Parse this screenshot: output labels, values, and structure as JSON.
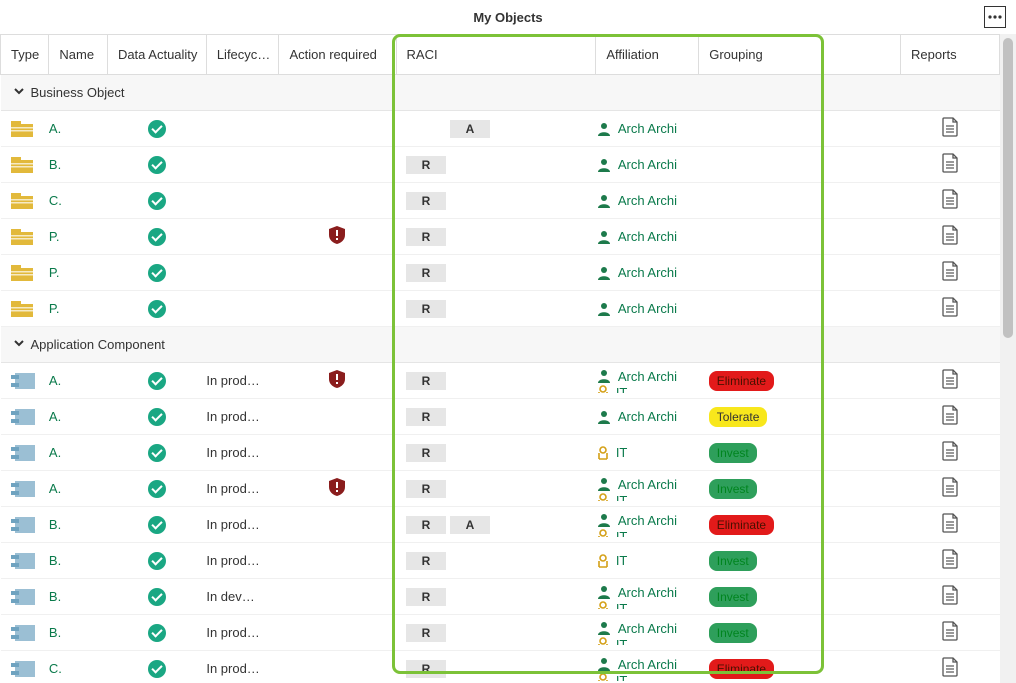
{
  "title": "My Objects",
  "columns": {
    "type": "Type",
    "name": "Name",
    "actuality": "Data Actuality",
    "lifecycle": "Lifecyc…",
    "action": "Action required",
    "raci": "RACI",
    "affiliation": "Affiliation",
    "grouping": "Grouping",
    "reports": "Reports"
  },
  "groups": [
    {
      "label": "Business Object",
      "rows": [
        {
          "name": "A.",
          "actuality": "ok",
          "lifecycle": "",
          "action": "",
          "raci": [
            "A"
          ],
          "raci_offset": 1,
          "aff": [
            {
              "icon": "person",
              "text": "Arch Archi"
            }
          ],
          "group": ""
        },
        {
          "name": "B.",
          "actuality": "ok",
          "lifecycle": "",
          "action": "",
          "raci": [
            "R"
          ],
          "aff": [
            {
              "icon": "person",
              "text": "Arch Archi"
            }
          ],
          "group": ""
        },
        {
          "name": "C.",
          "actuality": "ok",
          "lifecycle": "",
          "action": "",
          "raci": [
            "R"
          ],
          "aff": [
            {
              "icon": "person",
              "text": "Arch Archi"
            }
          ],
          "group": ""
        },
        {
          "name": "P.",
          "actuality": "ok",
          "lifecycle": "",
          "action": "alert",
          "raci": [
            "R"
          ],
          "aff": [
            {
              "icon": "person",
              "text": "Arch Archi"
            }
          ],
          "group": ""
        },
        {
          "name": "P.",
          "actuality": "ok",
          "lifecycle": "",
          "action": "",
          "raci": [
            "R"
          ],
          "aff": [
            {
              "icon": "person",
              "text": "Arch Archi"
            }
          ],
          "group": ""
        },
        {
          "name": "P.",
          "actuality": "ok",
          "lifecycle": "",
          "action": "",
          "raci": [
            "R"
          ],
          "aff": [
            {
              "icon": "person",
              "text": "Arch Archi"
            }
          ],
          "group": ""
        }
      ]
    },
    {
      "label": "Application Component",
      "rows": [
        {
          "name": "A.",
          "actuality": "ok",
          "lifecycle": "In prod…",
          "action": "alert",
          "raci": [
            "R"
          ],
          "aff": [
            {
              "icon": "person",
              "text": "Arch Archi"
            },
            {
              "icon": "badge",
              "text": "IT",
              "partial": true
            }
          ],
          "group": "Eliminate"
        },
        {
          "name": "A.",
          "actuality": "ok",
          "lifecycle": "In prod…",
          "action": "",
          "raci": [
            "R"
          ],
          "aff": [
            {
              "icon": "person",
              "text": "Arch Archi"
            }
          ],
          "group": "Tolerate"
        },
        {
          "name": "A.",
          "actuality": "ok",
          "lifecycle": "In prod…",
          "action": "",
          "raci": [
            "R"
          ],
          "aff": [
            {
              "icon": "badge",
              "text": "IT"
            }
          ],
          "group": "Invest"
        },
        {
          "name": "A.",
          "actuality": "ok",
          "lifecycle": "In prod…",
          "action": "alert",
          "raci": [
            "R"
          ],
          "aff": [
            {
              "icon": "person",
              "text": "Arch Archi"
            },
            {
              "icon": "badge",
              "text": "IT",
              "partial": true
            }
          ],
          "group": "Invest"
        },
        {
          "name": "B.",
          "actuality": "ok",
          "lifecycle": "In prod…",
          "action": "",
          "raci": [
            "R",
            "A"
          ],
          "aff": [
            {
              "icon": "person",
              "text": "Arch Archi"
            },
            {
              "icon": "badge",
              "text": "IT",
              "partial": true
            }
          ],
          "group": "Eliminate"
        },
        {
          "name": "B.",
          "actuality": "ok",
          "lifecycle": "In prod…",
          "action": "",
          "raci": [
            "R"
          ],
          "aff": [
            {
              "icon": "badge",
              "text": "IT"
            }
          ],
          "group": "Invest"
        },
        {
          "name": "B.",
          "actuality": "ok",
          "lifecycle": "In dev…",
          "action": "",
          "raci": [
            "R"
          ],
          "aff": [
            {
              "icon": "person",
              "text": "Arch Archi"
            },
            {
              "icon": "badge",
              "text": "IT",
              "partial": true
            }
          ],
          "group": "Invest"
        },
        {
          "name": "B.",
          "actuality": "ok",
          "lifecycle": "In prod…",
          "action": "",
          "raci": [
            "R"
          ],
          "aff": [
            {
              "icon": "person",
              "text": "Arch Archi"
            },
            {
              "icon": "badge",
              "text": "IT",
              "partial": true
            }
          ],
          "group": "Invest"
        },
        {
          "name": "C.",
          "actuality": "ok",
          "lifecycle": "In prod…",
          "action": "",
          "raci": [
            "R"
          ],
          "aff": [
            {
              "icon": "person",
              "text": "Arch Archi"
            },
            {
              "icon": "badge",
              "text": "IT",
              "partial": true
            }
          ],
          "group": "Eliminate"
        }
      ]
    }
  ],
  "pill_styles": {
    "Eliminate": "eliminate",
    "Tolerate": "tolerate",
    "Invest": "invest"
  }
}
